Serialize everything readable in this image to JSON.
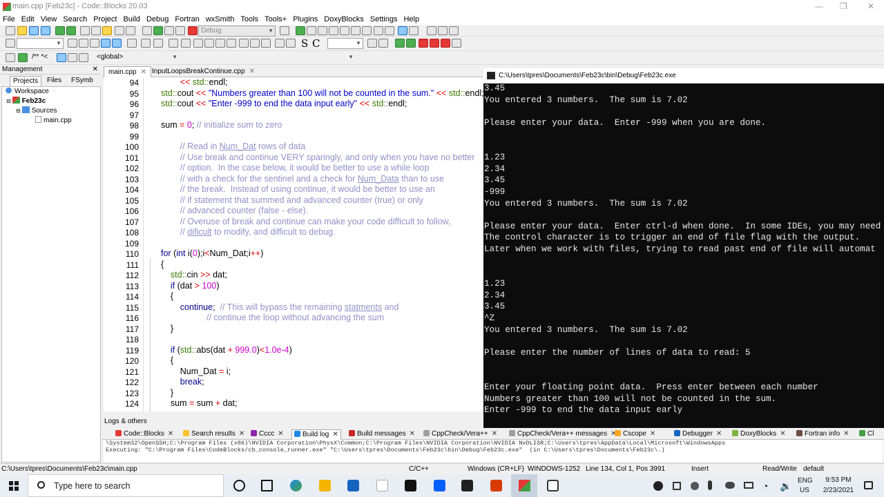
{
  "window": {
    "title": "main.cpp [Feb23c] - Code::Blocks 20.03"
  },
  "menu": [
    "File",
    "Edit",
    "View",
    "Search",
    "Project",
    "Build",
    "Debug",
    "Fortran",
    "wxSmith",
    "Tools",
    "Tools+",
    "Plugins",
    "DoxyBlocks",
    "Settings",
    "Help"
  ],
  "toolbar": {
    "build_target": "Debug",
    "scope": "<global>",
    "comment_glyph": "/** *<",
    "search_letters": [
      "S",
      "C"
    ]
  },
  "management": {
    "title": "Management",
    "tabs": [
      "Projects",
      "Files",
      "FSymb"
    ],
    "tree": {
      "workspace": "Workspace",
      "project": "Feb23c",
      "folder": "Sources",
      "file": "main.cpp"
    }
  },
  "editor": {
    "tabs": [
      "main.cpp",
      "InputLoopsBreakContinue.cpp"
    ],
    "line_numbers": [
      "94",
      "95",
      "96",
      "97",
      "98",
      "99",
      "100",
      "101",
      "102",
      "103",
      "104",
      "105",
      "106",
      "107",
      "108",
      "109",
      "110",
      "111",
      "112",
      "113",
      "114",
      "115",
      "116",
      "117",
      "118",
      "119",
      "120",
      "121",
      "122",
      "123",
      "124"
    ],
    "lines": [
      "        << std::endl;",
      "std::cout << \"Numbers greater than 100 will not be counted in the sum.\" << std::endl;",
      "std::cout << \"Enter -999 to end the data input early\" << std::endl;",
      "",
      "sum = 0; // initialize sum to zero",
      "",
      "        // Read in Num_Dat rows of data",
      "        // Use break and continue VERY sparingly, and only when you have no better",
      "        // option.  In the case below, it would be better to use a while loop",
      "        // with a check for the sentinel and a check for Num_Data than to use",
      "        // the break.  Instead of using continue, it would be better to use an",
      "        // if statement that summed and advanced counter (true) or only",
      "        // advanced counter (false - else).",
      "        // Overuse of break and continue can make your code difficult to follow,",
      "        // dificult to modify, and difficult to debug.",
      "",
      "for (int i(0);i<Num_Dat;i++)",
      "{",
      "    std::cin >> dat;",
      "    if (dat > 100)",
      "    {",
      "        continue;  // This will bypass the remaining statments and",
      "                   // continue the loop without advancing the sum",
      "    }",
      "",
      "    if (std::abs(dat + 999.0)<1.0e-4)",
      "    {",
      "        Num_Dat = i;",
      "        break;",
      "    }",
      "    sum = sum + dat;"
    ]
  },
  "console": {
    "title": "C:\\Users\\tpres\\Documents\\Feb23c\\bin\\Debug\\Feb23c.exe",
    "lines": [
      "3.45",
      "You entered 3 numbers.  The sum is 7.02",
      "",
      "Please enter your data.  Enter -999 when you are done.",
      "",
      "",
      "1.23",
      "2.34",
      "3.45",
      "-999",
      "You entered 3 numbers.  The sum is 7.02",
      "",
      "Please enter your data.  Enter ctrl-d when done.  In some IDEs, you may need",
      "The control character is to trigger an end of file flag with the output.",
      "Later when we work with files, trying to read past end of file will automat",
      "",
      "",
      "1.23",
      "2.34",
      "3.45",
      "^Z",
      "You entered 3 numbers.  The sum is 7.02",
      "",
      "Please enter the number of lines of data to read: 5",
      "",
      "",
      "Enter your floating point data.  Press enter between each number",
      "Numbers greater than 100 will not be counted in the sum.",
      "Enter -999 to end the data input early"
    ]
  },
  "logs": {
    "title": "Logs & others",
    "tabs": [
      "Code::Blocks",
      "Search results",
      "Cccc",
      "Build log",
      "Build messages",
      "CppCheck/Vera++",
      "CppCheck/Vera++ messages",
      "Cscope",
      "Debugger",
      "DoxyBlocks",
      "Fortran info",
      "Cl"
    ],
    "active_tab": "Build log",
    "lines": [
      "\\System32\\OpenSSH;C:\\Program Files (x86)\\NVIDIA Corporation\\PhysX\\Common;C:\\Program Files\\NVIDIA Corporation\\NVIDIA NvDLISR;C:\\Users\\tpres\\AppData\\Local\\Microsoft\\WindowsApps",
      "Executing: \"C:\\Program Files\\CodeBlocks/cb_console_runner.exe\" \"C:\\Users\\tpres\\Documents\\Feb23c\\bin\\Debug\\Feb23c.exe\"  (in C:\\Users\\tpres\\Documents\\Feb23c\\.)"
    ]
  },
  "status": {
    "path": "C:\\Users\\tpres\\Documents\\Feb23c\\main.cpp",
    "language": "C/C++",
    "eol": "Windows (CR+LF)",
    "encoding": "WINDOWS-1252",
    "position": "Line 134, Col 1, Pos 3991",
    "mode": "Insert",
    "access": "Read/Write",
    "profile": "default"
  },
  "taskbar": {
    "search_placeholder": "Type here to search",
    "lang_top": "ENG",
    "lang_bottom": "US",
    "time": "9:53 PM",
    "date": "2/23/2021"
  }
}
